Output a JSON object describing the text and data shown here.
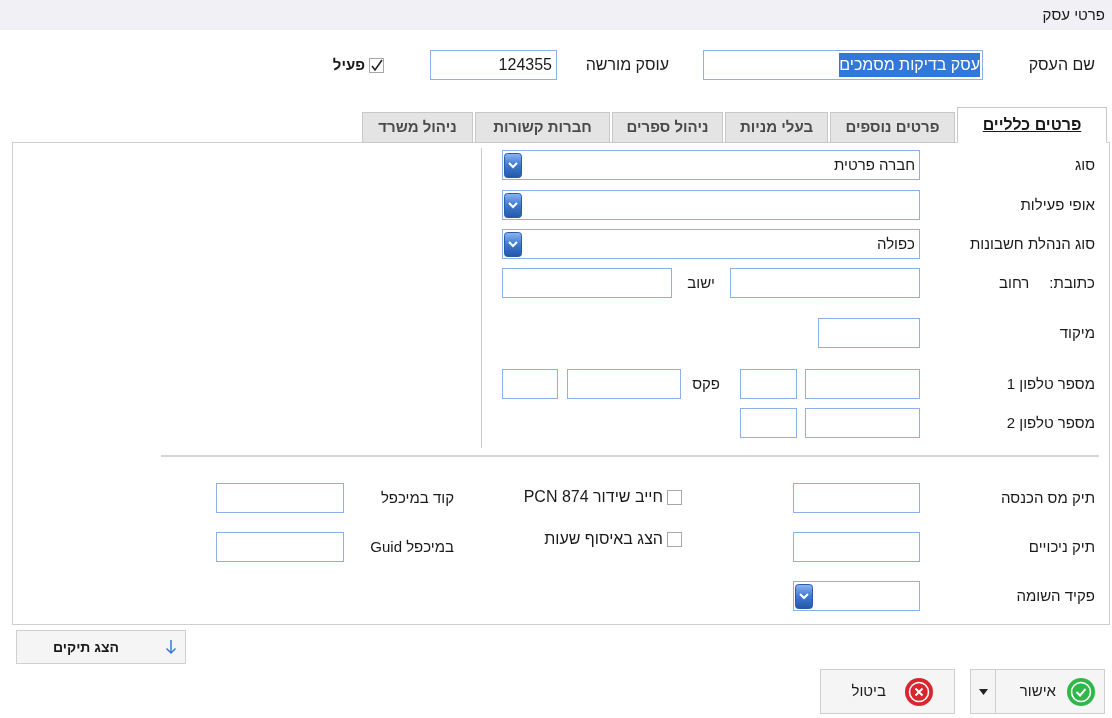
{
  "window": {
    "title": "פרטי עסק"
  },
  "header": {
    "business_name": {
      "label": "שם העסק",
      "value": "עסק בדיקות מסמכים",
      "selected": true
    },
    "vat_number": {
      "label": "עוסק מורשה",
      "value": "124355"
    },
    "active": {
      "label": "פעיל",
      "checked": true
    }
  },
  "tabs": [
    {
      "label": "פרטים כלליים",
      "selected": true
    },
    {
      "label": "פרטים נוספים",
      "selected": false
    },
    {
      "label": "בעלי מניות",
      "selected": false
    },
    {
      "label": "ניהול ספרים",
      "selected": false
    },
    {
      "label": "חברות קשורות",
      "selected": false
    },
    {
      "label": "ניהול משרד",
      "selected": false
    }
  ],
  "general": {
    "rows": [
      {
        "labels": [
          "סוג"
        ],
        "fields": [
          {
            "kind": "dropdown",
            "value": "חברה פרטית"
          }
        ]
      },
      {
        "labels": [
          "אופי פעילות"
        ],
        "fields": [
          {
            "kind": "dropdown"
          }
        ]
      },
      {
        "labels": [
          "סוג הנהלת חשבונות"
        ],
        "fields": [
          {
            "kind": "dropdown",
            "value": "כפולה"
          }
        ]
      },
      {
        "labels": [
          "כתובת:",
          "רחוב"
        ],
        "fields": [
          {
            "kind": "input"
          },
          {
            "kind": "label",
            "text": "ישוב"
          },
          {
            "kind": "input"
          }
        ]
      },
      {
        "labels": [
          "מיקוד"
        ],
        "fields": [
          {
            "kind": "input"
          }
        ]
      },
      {
        "labels": [
          "מספר טלפון 1"
        ],
        "fields": [
          {
            "kind": "input"
          },
          {
            "kind": "input"
          },
          {
            "kind": "label",
            "text": "פקס"
          },
          {
            "kind": "input"
          },
          {
            "kind": "input"
          }
        ]
      },
      {
        "labels": [
          "מספר טלפון 2"
        ],
        "fields": [
          {
            "kind": "input"
          },
          {
            "kind": "input"
          }
        ]
      }
    ]
  },
  "tax_files": [
    {
      "label": "תיק מס הכנסה",
      "kind": "input"
    },
    {
      "label": "תיק ניכויים",
      "kind": "input"
    },
    {
      "label": "פקיד השומה",
      "kind": "dropdown"
    }
  ],
  "flags": [
    {
      "label": "חייב שידור PCN 874",
      "checked": false
    },
    {
      "label": "הצג באיסוף שעות",
      "checked": false
    }
  ],
  "cross_reference": [
    {
      "label": "קוד במיכפל",
      "kind": "code"
    },
    {
      "label": "Guid במיכפל",
      "kind": "guid"
    }
  ],
  "show_files_button": {
    "label": "הצג תיקים"
  },
  "actions": [
    {
      "kind": "confirm",
      "label": "אישור"
    },
    {
      "kind": "cancel",
      "label": "ביטול"
    }
  ]
}
